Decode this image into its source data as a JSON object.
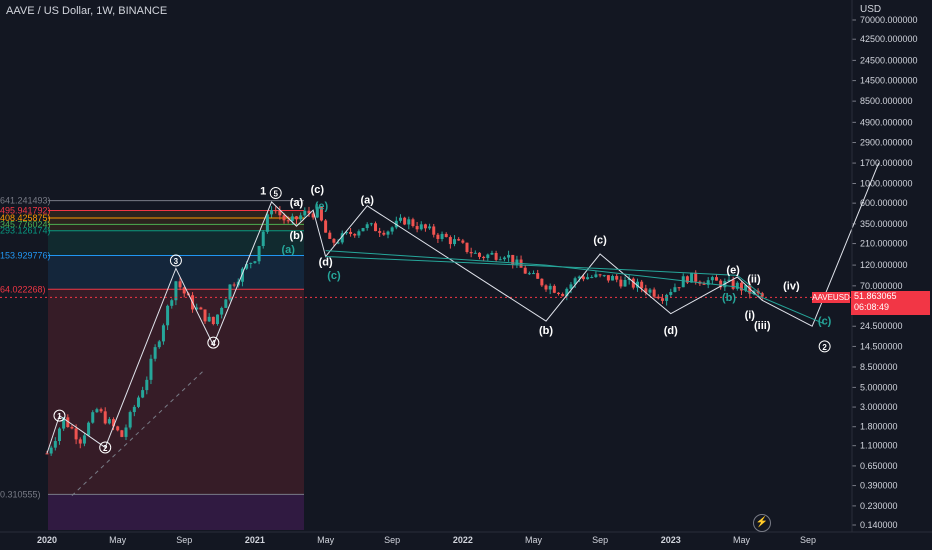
{
  "title": "AAVE / US Dollar, 1W, BINANCE",
  "currency": "USD",
  "symbol_tag": "AAVEUSD",
  "last_price": "51.863065",
  "countdown": "06:08:49",
  "bolt_icon": "lightning-icon",
  "colors": {
    "background": "#131722",
    "up": "#26a69a",
    "down": "#ef5350",
    "text": "#d1d4dc",
    "price": "#f23645"
  },
  "chart_data": {
    "type": "candlestick",
    "y_scale": "log",
    "y_ticks": [
      "70000.000000",
      "42500.000000",
      "24500.000000",
      "14500.000000",
      "8500.000000",
      "4900.000000",
      "2900.000000",
      "1700.000000",
      "1000.000000",
      "600.000000",
      "350.000000",
      "210.000000",
      "120.000000",
      "70.000000",
      "40.000000",
      "24.500000",
      "14.500000",
      "8.500000",
      "5.000000",
      "3.000000",
      "1.800000",
      "1.100000",
      "0.650000",
      "0.390000",
      "0.230000",
      "0.140000"
    ],
    "y_tick_values": [
      70000,
      42500,
      24500,
      14500,
      8500,
      4900,
      2900,
      1700,
      1000,
      600,
      350,
      210,
      120,
      70,
      40,
      24.5,
      14.5,
      8.5,
      5,
      3,
      1.8,
      1.1,
      0.65,
      0.39,
      0.23,
      0.14
    ],
    "x_ticks": [
      "2020",
      "May",
      "Sep",
      "2021",
      "May",
      "Sep",
      "2022",
      "May",
      "Sep",
      "2023",
      "May",
      "Sep"
    ],
    "x_tick_bold": [
      true,
      false,
      false,
      true,
      false,
      false,
      true,
      false,
      false,
      true,
      false,
      false
    ],
    "x_tick_t": [
      0,
      17,
      33,
      50,
      67,
      83,
      100,
      117,
      133,
      150,
      167,
      183
    ],
    "ohlc_anchors": [
      {
        "t": 0,
        "c": 0.9
      },
      {
        "t": 4,
        "c": 2.2
      },
      {
        "t": 8,
        "c": 1.3
      },
      {
        "t": 12,
        "c": 2.8
      },
      {
        "t": 18,
        "c": 1.4
      },
      {
        "t": 24,
        "c": 6.5
      },
      {
        "t": 31,
        "c": 80
      },
      {
        "t": 35,
        "c": 42
      },
      {
        "t": 40,
        "c": 26
      },
      {
        "t": 44,
        "c": 70
      },
      {
        "t": 50,
        "c": 150
      },
      {
        "t": 54,
        "c": 560
      },
      {
        "t": 58,
        "c": 350
      },
      {
        "t": 62,
        "c": 460
      },
      {
        "t": 65,
        "c": 480
      },
      {
        "t": 68,
        "c": 210
      },
      {
        "t": 72,
        "c": 260
      },
      {
        "t": 76,
        "c": 330
      },
      {
        "t": 82,
        "c": 300
      },
      {
        "t": 86,
        "c": 390
      },
      {
        "t": 92,
        "c": 290
      },
      {
        "t": 98,
        "c": 220
      },
      {
        "t": 104,
        "c": 150
      },
      {
        "t": 110,
        "c": 165
      },
      {
        "t": 114,
        "c": 110
      },
      {
        "t": 118,
        "c": 80
      },
      {
        "t": 124,
        "c": 60
      },
      {
        "t": 128,
        "c": 90
      },
      {
        "t": 136,
        "c": 85
      },
      {
        "t": 142,
        "c": 70
      },
      {
        "t": 148,
        "c": 55
      },
      {
        "t": 154,
        "c": 88
      },
      {
        "t": 160,
        "c": 78
      },
      {
        "t": 166,
        "c": 70
      },
      {
        "t": 172,
        "c": 52
      }
    ],
    "fib_levels": [
      {
        "label": "641.241493",
        "value": 641.24,
        "color": "#787b86"
      },
      {
        "label": "495.941792",
        "value": 495.94,
        "color": "#f23645"
      },
      {
        "label": "408.425875",
        "value": 408.43,
        "color": "#ff9800"
      },
      {
        "label": "345.776024",
        "value": 345.78,
        "color": "#4caf50"
      },
      {
        "label": "293.126174",
        "value": 293.13,
        "color": "#089981"
      },
      {
        "label": "153.929776",
        "value": 153.93,
        "color": "#2196f3"
      },
      {
        "label": "64.022268",
        "value": 64.02,
        "color": "#f23645"
      },
      {
        "label": "0.310555",
        "value": 0.310555,
        "color": "#787b86"
      }
    ],
    "wave_labels": [
      {
        "text": "1",
        "t": 3,
        "v": 2.4,
        "circled": true
      },
      {
        "text": "2",
        "t": 14,
        "v": 1.05,
        "circled": true
      },
      {
        "text": "3",
        "t": 31,
        "v": 135,
        "circled": true
      },
      {
        "text": "4",
        "t": 40,
        "v": 16,
        "circled": true
      },
      {
        "text": "1",
        "t": 52,
        "v": 820,
        "circled": false
      },
      {
        "text": "5",
        "t": 55,
        "v": 780,
        "circled": true
      },
      {
        "text": "(a)",
        "t": 58,
        "v": 180,
        "circled": false,
        "color": "#26a69a"
      },
      {
        "text": "(a)",
        "t": 60,
        "v": 610,
        "circled": false
      },
      {
        "text": "(b)",
        "t": 60,
        "v": 260,
        "circled": false
      },
      {
        "text": "(c)",
        "t": 65,
        "v": 860,
        "circled": false
      },
      {
        "text": "(e)",
        "t": 66,
        "v": 560,
        "circled": false,
        "color": "#26a69a"
      },
      {
        "text": "(d)",
        "t": 67,
        "v": 130,
        "circled": false
      },
      {
        "text": "(c)",
        "t": 69,
        "v": 92,
        "circled": false,
        "color": "#26a69a"
      },
      {
        "text": "(a)",
        "t": 77,
        "v": 650,
        "circled": false
      },
      {
        "text": "(b)",
        "t": 120,
        "v": 22,
        "circled": false
      },
      {
        "text": "(c)",
        "t": 133,
        "v": 230,
        "circled": false
      },
      {
        "text": "(d)",
        "t": 150,
        "v": 22,
        "circled": false
      },
      {
        "text": "(e)",
        "t": 165,
        "v": 105,
        "circled": false
      },
      {
        "text": "(ii)",
        "t": 170,
        "v": 84,
        "circled": false
      },
      {
        "text": "(b)",
        "t": 164,
        "v": 52,
        "circled": false,
        "color": "#26a69a"
      },
      {
        "text": "(i)",
        "t": 169,
        "v": 33,
        "circled": false
      },
      {
        "text": "(iii)",
        "t": 172,
        "v": 25,
        "circled": false
      },
      {
        "text": "(iv)",
        "t": 179,
        "v": 70,
        "circled": false
      },
      {
        "text": "(c)",
        "t": 187,
        "v": 28,
        "circled": false,
        "color": "#26a69a"
      },
      {
        "text": "2",
        "t": 187,
        "v": 14.5,
        "circled": true
      }
    ]
  }
}
